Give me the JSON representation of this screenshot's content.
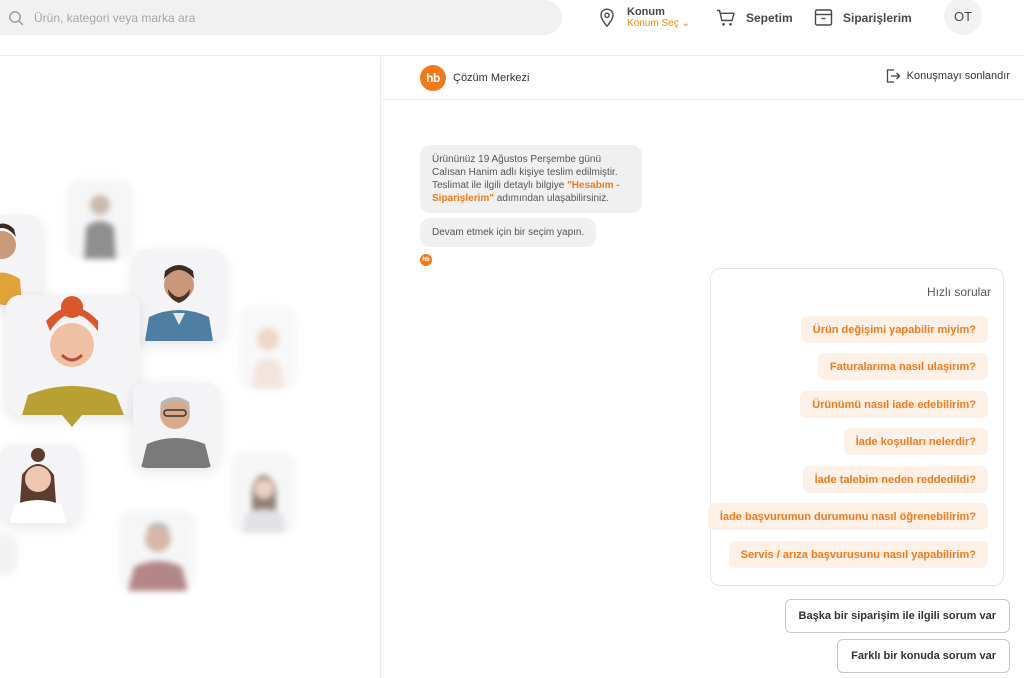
{
  "header": {
    "search_placeholder": "Ürün, kategori veya marka ara",
    "location_label": "Konum",
    "location_action": "Konum Seç",
    "cart_label": "Sepetim",
    "orders_label": "Siparişlerim",
    "avatar_initials": "OT"
  },
  "chat": {
    "logo_text": "hb",
    "title": "Çözüm Merkezi",
    "end_chat": "Konuşmayı sonlandır",
    "message1": {
      "text_before": "Ürününüz 19 Ağustos Perşembe günü Calısan Hanim adlı kişiye teslim edilmiştir. Teslimat ile ilgili detaylı bilgiye ",
      "highlight": "\"Hesabım - Siparişlerim\"",
      "text_after": " adımından ulaşabilirsiniz."
    },
    "message2": "Devam etmek için bir seçim yapın.",
    "quick_title": "Hızlı sorular",
    "quick_questions": [
      "Ürün değişimi yapabilir miyim?",
      "Faturalarıma nasıl ulaşırım?",
      "Ürünümü nasıl iade edebilirim?",
      "İade koşulları nelerdir?",
      "İade talebim neden reddedildi?",
      "İade başvurumun durumunu nasıl öğrenebilirim?",
      "Servis / arıza başvurusunu nasıl yapabilirim?"
    ],
    "actions": [
      "Başka bir siparişim ile ilgili sorum var",
      "Farklı bir konuda sorum var"
    ]
  },
  "colors": {
    "accent": "#f27a1a",
    "accent_soft": "#fdf1e7",
    "bubble": "#f0f0f0"
  }
}
